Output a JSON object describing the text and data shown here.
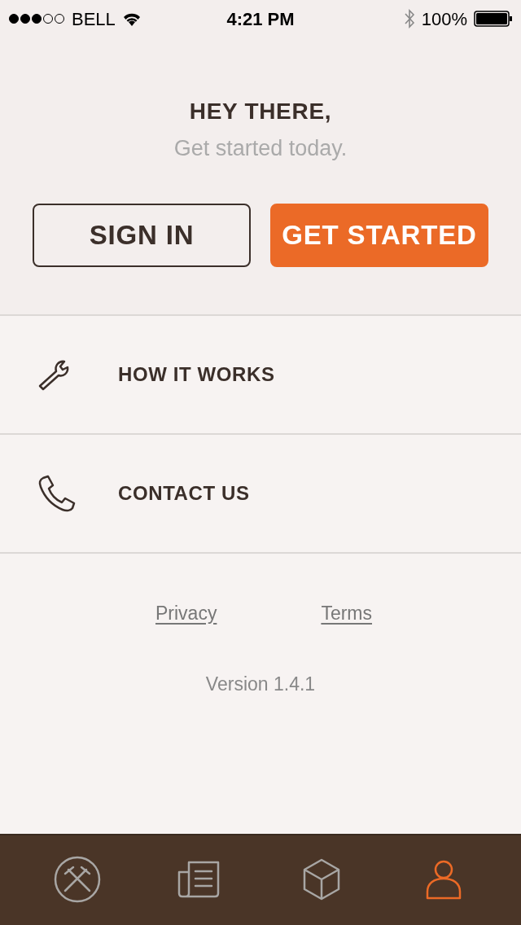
{
  "status_bar": {
    "carrier": "BELL",
    "time": "4:21 PM",
    "battery": "100%"
  },
  "header": {
    "title": "HEY THERE,",
    "subtitle": "Get started today."
  },
  "buttons": [
    {
      "label": "SIGN IN",
      "kind": "outline"
    },
    {
      "label": "GET STARTED",
      "kind": "primary"
    }
  ],
  "menu": [
    {
      "label": "HOW IT WORKS",
      "kind": "wrench"
    },
    {
      "label": "CONTACT US",
      "kind": "phone"
    }
  ],
  "links": [
    "Privacy",
    "Terms"
  ],
  "version": "Version 1.4.1",
  "tab_bar": [
    {
      "kind": "tools",
      "selected": false
    },
    {
      "kind": "news",
      "selected": false
    },
    {
      "kind": "box",
      "selected": false
    },
    {
      "kind": "profile",
      "selected": true
    }
  ]
}
